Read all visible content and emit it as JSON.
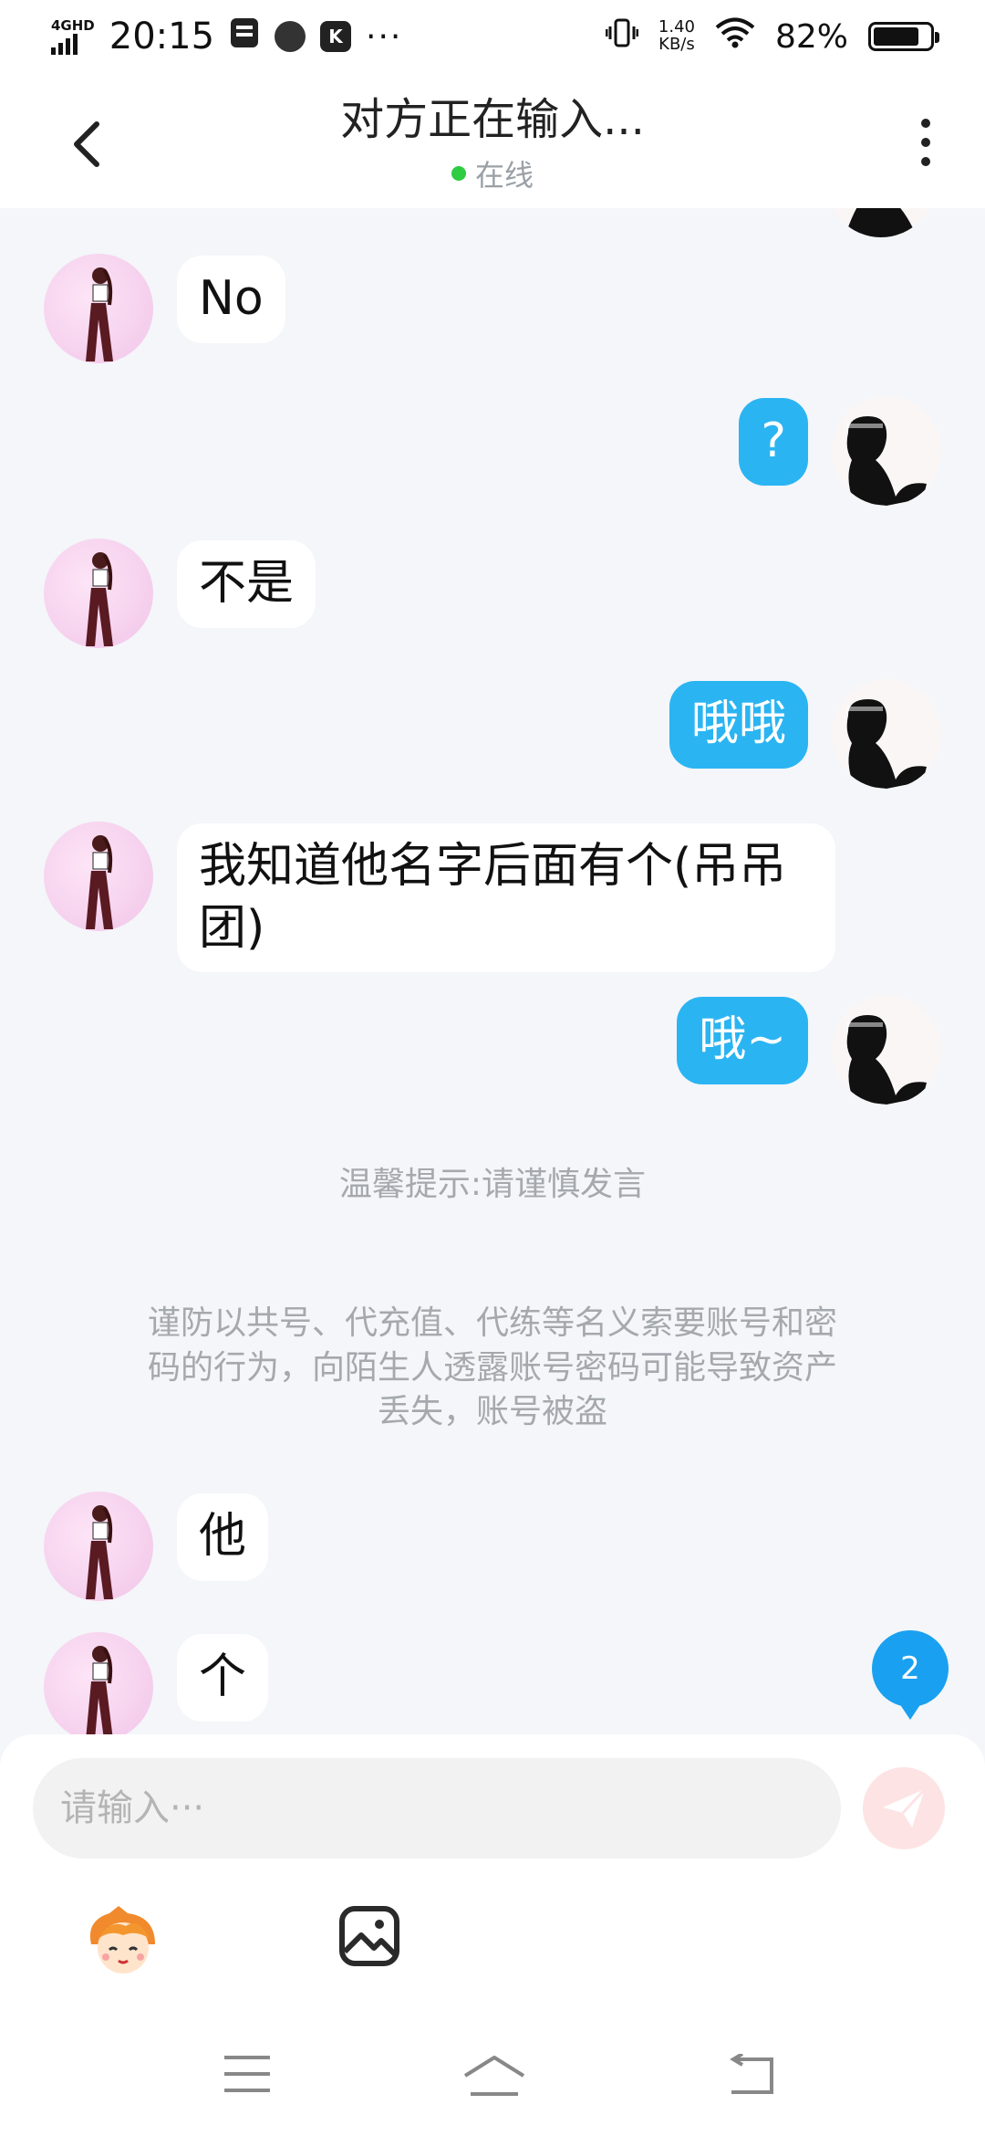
{
  "status_bar": {
    "network": "4GHD",
    "time": "20:15",
    "k_label": "K",
    "more": "···",
    "speed_value": "1.40",
    "speed_unit": "KB/s",
    "battery_pct": "82%",
    "battery_level": 0.82
  },
  "header": {
    "title": "对方正在输入...",
    "status": "在线",
    "status_color": "#2ecc40"
  },
  "messages": [
    {
      "side": "in",
      "text": "No"
    },
    {
      "side": "out",
      "text": "?"
    },
    {
      "side": "in",
      "text": "不是"
    },
    {
      "side": "out",
      "text": "哦哦"
    },
    {
      "side": "in",
      "text_line1": "我知道他名字后面有个(吊吊",
      "text_line2": "团)"
    },
    {
      "side": "out",
      "text": "哦~"
    },
    {
      "side": "in",
      "text": "他"
    },
    {
      "side": "in",
      "text": "个"
    }
  ],
  "notices": {
    "tip": "温馨提示:请谨慎发言",
    "warning_line1": "谨防以共号、代充值、代练等名义索要账号和密",
    "warning_line2": "码的行为，向陌生人透露账号密码可能导致资产",
    "warning_line3": "丢失，账号被盗"
  },
  "unread_badge": "2",
  "composer": {
    "placeholder": "请输入···"
  },
  "colors": {
    "accent": "#2bb4f2",
    "background": "#f4f6f9",
    "badge": "#1aa0f0"
  },
  "icons": {
    "back": "chevron-left-icon",
    "menu": "more-vertical-icon",
    "send": "paper-plane-icon",
    "emoji": "emoji-face-icon",
    "image": "image-icon",
    "nav_menu": "menu-lines-icon",
    "nav_home": "home-icon",
    "nav_back": "return-icon"
  }
}
